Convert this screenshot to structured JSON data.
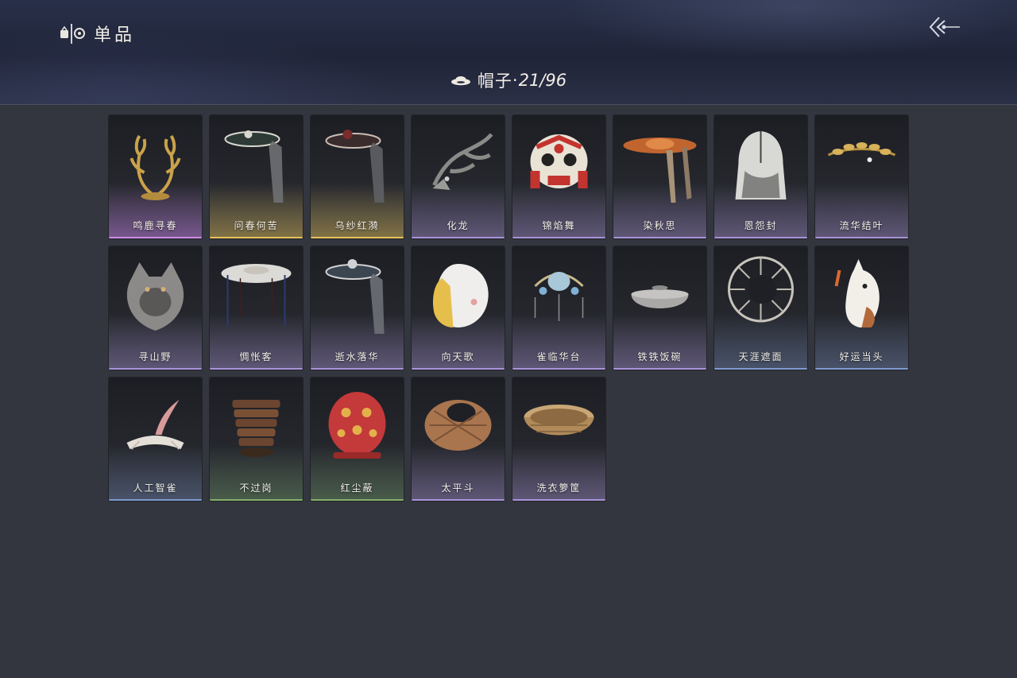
{
  "header": {
    "title": "单品",
    "title_icon": "wardrobe-icon",
    "back_icon": "back-arrow-icon"
  },
  "category": {
    "icon": "hat-icon",
    "label": "帽子",
    "separator": "·",
    "count": "21/96"
  },
  "rarity_colors": {
    "purple": "#d08be8",
    "gold": "#e6c45a",
    "lavender": "#a893d8",
    "blue": "#7f9bd0",
    "green": "#84b06b"
  },
  "items": [
    {
      "name": "鸣鹿寻春",
      "rarity": "purple",
      "art": "antler-headdress"
    },
    {
      "name": "问春何苦",
      "rarity": "gold",
      "art": "veiled-hat"
    },
    {
      "name": "乌纱红漪",
      "rarity": "gold",
      "art": "veiled-hat-red"
    },
    {
      "name": "化龙",
      "rarity": "lavender",
      "art": "dragon-head"
    },
    {
      "name": "锦焰舞",
      "rarity": "lavender",
      "art": "lion-dance-head"
    },
    {
      "name": "染秋思",
      "rarity": "lavender",
      "art": "orange-straw-hat"
    },
    {
      "name": "恩怨封",
      "rarity": "lavender",
      "art": "ink-hood"
    },
    {
      "name": "流华结叶",
      "rarity": "lavender",
      "art": "golden-leaf-crown"
    },
    {
      "name": "寻山野",
      "rarity": "lavender",
      "art": "wolf-hood"
    },
    {
      "name": "惆怅客",
      "rarity": "lavender",
      "art": "white-bamboo-hat"
    },
    {
      "name": "逝水落华",
      "rarity": "lavender",
      "art": "veiled-hat-silver"
    },
    {
      "name": "向天歌",
      "rarity": "lavender",
      "art": "goose-hood"
    },
    {
      "name": "雀临华台",
      "rarity": "lavender",
      "art": "blue-phoenix-crown"
    },
    {
      "name": "铁铁饭碗",
      "rarity": "lavender",
      "art": "iron-bowl"
    },
    {
      "name": "天涯遮面",
      "rarity": "blue",
      "art": "wire-hat"
    },
    {
      "name": "好运当头",
      "rarity": "blue",
      "art": "horse-head"
    },
    {
      "name": "人工智雀",
      "rarity": "blue",
      "art": "paper-bird"
    },
    {
      "name": "不过岗",
      "rarity": "green",
      "art": "bowl-stack"
    },
    {
      "name": "红尘蔽",
      "rarity": "green",
      "art": "red-hood"
    },
    {
      "name": "太平斗",
      "rarity": "lavender",
      "art": "wicker-basket-hat"
    },
    {
      "name": "洗衣箩筐",
      "rarity": "lavender",
      "art": "laundry-basket"
    }
  ]
}
